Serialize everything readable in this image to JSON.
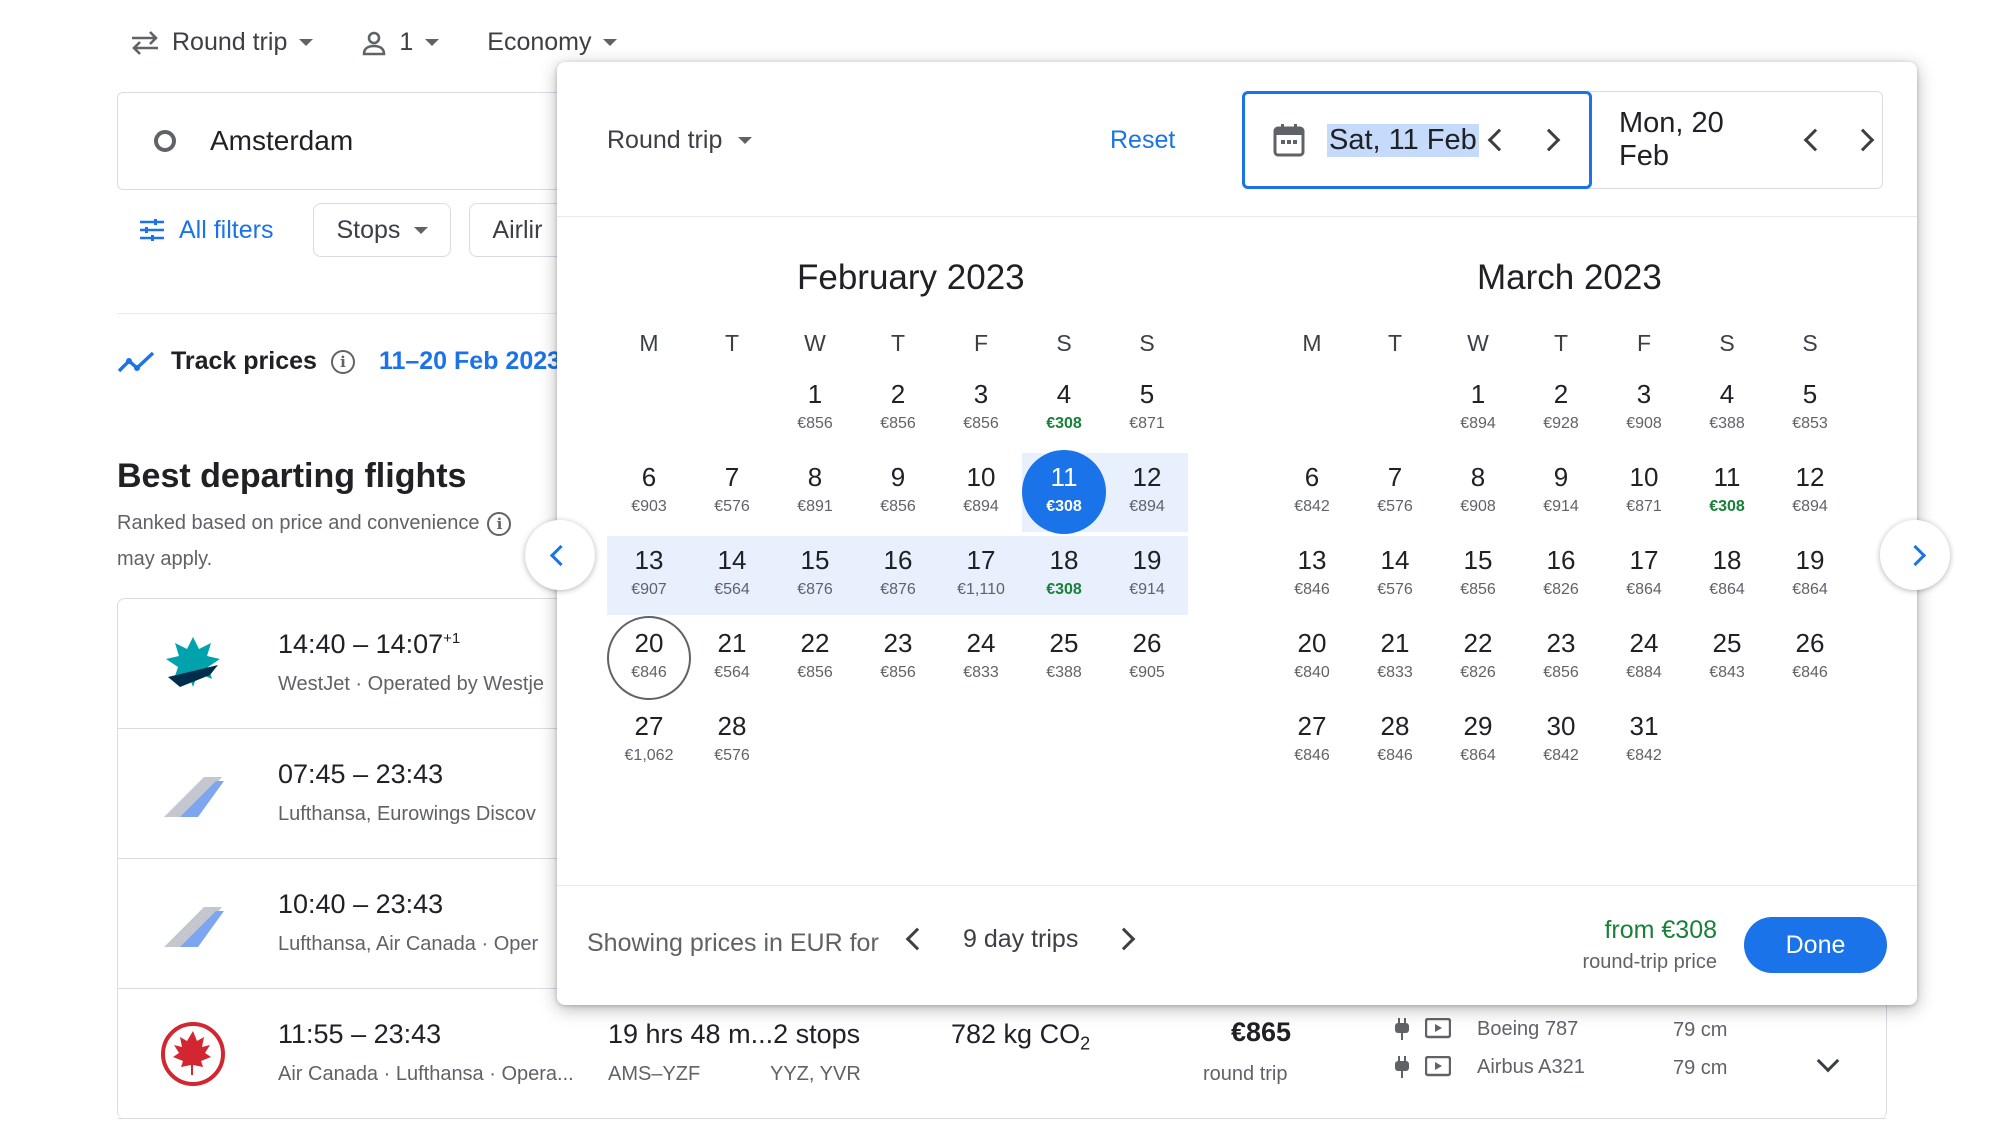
{
  "topbar": {
    "trip_type": "Round trip",
    "passengers": "1",
    "cabin": "Economy"
  },
  "origin": {
    "value": "Amsterdam"
  },
  "filters": {
    "all_filters": "All filters",
    "stops": "Stops",
    "airlines_partial": "Airlir"
  },
  "track": {
    "label": "Track prices",
    "dates": "11–20 Feb 2023"
  },
  "best": {
    "title": "Best departing flights",
    "subtitle_line1": "Ranked based on price and convenience",
    "subtitle_line2": "may apply."
  },
  "flights": [
    {
      "time": "14:40 – 14:07",
      "plus": "+1",
      "airline": "WestJet · Operated by Westje",
      "logo": "westjet-logo"
    },
    {
      "time": "07:45 – 23:43",
      "plus": "",
      "airline": "Lufthansa, Eurowings Discov",
      "logo": "lufthansa-tail-logo"
    },
    {
      "time": "10:40 – 23:43",
      "plus": "",
      "airline": "Lufthansa, Air Canada · Oper",
      "logo": "lufthansa-tail-logo"
    },
    {
      "time": "11:55 – 23:43",
      "plus": "",
      "airline": "Air Canada · Lufthansa · Opera...",
      "logo": "air-canada-logo",
      "duration": "19 hrs 48 m...2 stops",
      "route": "AMS–YZF",
      "stops_detail": "YYZ, YVR",
      "co2": "782 kg CO",
      "co2_sub": "2",
      "price": "€865",
      "price_type": "round trip",
      "aircraft1": "Boeing 787",
      "legroom1": "79 cm",
      "aircraft2": "Airbus A321",
      "legroom2": "79 cm"
    }
  ],
  "popup": {
    "trip_type": "Round trip",
    "reset": "Reset",
    "departure": "Sat, 11 Feb",
    "return": "Mon, 20 Feb",
    "weekdays": [
      "M",
      "T",
      "W",
      "T",
      "F",
      "S",
      "S"
    ],
    "feb": {
      "title": "February 2023",
      "days": [
        {
          "d": "1",
          "p": "€856"
        },
        {
          "d": "2",
          "p": "€856"
        },
        {
          "d": "3",
          "p": "€856"
        },
        {
          "d": "4",
          "p": "€308",
          "c": true
        },
        {
          "d": "5",
          "p": "€871"
        },
        {
          "d": "6",
          "p": "€903"
        },
        {
          "d": "7",
          "p": "€576"
        },
        {
          "d": "8",
          "p": "€891"
        },
        {
          "d": "9",
          "p": "€856"
        },
        {
          "d": "10",
          "p": "€894"
        },
        {
          "d": "11",
          "p": "€308",
          "c": true
        },
        {
          "d": "12",
          "p": "€894"
        },
        {
          "d": "13",
          "p": "€907"
        },
        {
          "d": "14",
          "p": "€564"
        },
        {
          "d": "15",
          "p": "€876"
        },
        {
          "d": "16",
          "p": "€876"
        },
        {
          "d": "17",
          "p": "€1,110"
        },
        {
          "d": "18",
          "p": "€308",
          "c": true
        },
        {
          "d": "19",
          "p": "€914"
        },
        {
          "d": "20",
          "p": "€846"
        },
        {
          "d": "21",
          "p": "€564"
        },
        {
          "d": "22",
          "p": "€856"
        },
        {
          "d": "23",
          "p": "€856"
        },
        {
          "d": "24",
          "p": "€833"
        },
        {
          "d": "25",
          "p": "€388"
        },
        {
          "d": "26",
          "p": "€905"
        },
        {
          "d": "27",
          "p": "€1,062"
        },
        {
          "d": "28",
          "p": "€576"
        }
      ]
    },
    "mar": {
      "title": "March 2023",
      "days": [
        {
          "d": "1",
          "p": "€894"
        },
        {
          "d": "2",
          "p": "€928"
        },
        {
          "d": "3",
          "p": "€908"
        },
        {
          "d": "4",
          "p": "€388"
        },
        {
          "d": "5",
          "p": "€853"
        },
        {
          "d": "6",
          "p": "€842"
        },
        {
          "d": "7",
          "p": "€576"
        },
        {
          "d": "8",
          "p": "€908"
        },
        {
          "d": "9",
          "p": "€914"
        },
        {
          "d": "10",
          "p": "€871"
        },
        {
          "d": "11",
          "p": "€308",
          "c": true
        },
        {
          "d": "12",
          "p": "€894"
        },
        {
          "d": "13",
          "p": "€846"
        },
        {
          "d": "14",
          "p": "€576"
        },
        {
          "d": "15",
          "p": "€856"
        },
        {
          "d": "16",
          "p": "€826"
        },
        {
          "d": "17",
          "p": "€864"
        },
        {
          "d": "18",
          "p": "€864"
        },
        {
          "d": "19",
          "p": "€864"
        },
        {
          "d": "20",
          "p": "€840"
        },
        {
          "d": "21",
          "p": "€833"
        },
        {
          "d": "22",
          "p": "€826"
        },
        {
          "d": "23",
          "p": "€856"
        },
        {
          "d": "24",
          "p": "€884"
        },
        {
          "d": "25",
          "p": "€843"
        },
        {
          "d": "26",
          "p": "€846"
        },
        {
          "d": "27",
          "p": "€846"
        },
        {
          "d": "28",
          "p": "€846"
        },
        {
          "d": "29",
          "p": "€864"
        },
        {
          "d": "30",
          "p": "€842"
        },
        {
          "d": "31",
          "p": "€842"
        }
      ]
    },
    "footer": {
      "showing": "Showing prices in EUR for",
      "trips": "9 day trips",
      "from_price": "from €308",
      "from_sub": "round-trip price",
      "done": "Done"
    }
  },
  "colors": {
    "accent": "#1a73e8",
    "cheap": "#188038",
    "range": "#e8f0fe",
    "air_canada_red": "#d22630",
    "westjet_teal": "#00a3ad"
  }
}
